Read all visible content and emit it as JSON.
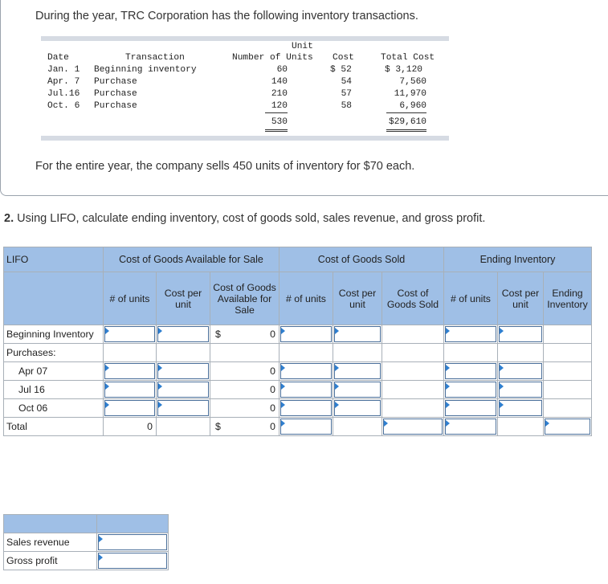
{
  "intro": {
    "sentence": "During  the year, TRC Corporation has the following inventory transactions.",
    "closing": "For the entire year, the company sells 450 units of inventory for $70 each."
  },
  "transactions": {
    "headers": {
      "date": "Date",
      "transaction": "Transaction",
      "units": "Number of Units",
      "unit_cost_top": "Unit",
      "unit_cost": "Cost",
      "total_cost": "Total Cost"
    },
    "rows": [
      {
        "date": "Jan. 1",
        "transaction": "Beginning inventory",
        "units": "60",
        "unit_cost": "$ 52",
        "total_cost": "$ 3,120"
      },
      {
        "date": "Apr. 7",
        "transaction": "Purchase",
        "units": "140",
        "unit_cost": "54",
        "total_cost": "7,560"
      },
      {
        "date": "Jul.16",
        "transaction": "Purchase",
        "units": "210",
        "unit_cost": "57",
        "total_cost": "11,970"
      },
      {
        "date": "Oct. 6",
        "transaction": "Purchase",
        "units": "120",
        "unit_cost": "58",
        "total_cost": "6,960"
      }
    ],
    "totals": {
      "units": "530",
      "total_cost": "$29,610"
    }
  },
  "question": {
    "number": "2.",
    "text": " Using LIFO, calculate ending inventory, cost of goods sold, sales revenue, and gross profit."
  },
  "lifo_table": {
    "method_label": "LIFO",
    "groups": {
      "available": "Cost of Goods Available for Sale",
      "sold": "Cost of Goods Sold",
      "ending": "Ending Inventory"
    },
    "subheaders": {
      "units": "# of units",
      "cost_per_unit": "Cost per unit",
      "cogas": "Cost of Goods Available for Sale",
      "units2": "# of units",
      "cost_per_unit2": "Cost per unit",
      "cogs": "Cost of Goods Sold",
      "units3": "# of units",
      "cost_per_unit3": "Cost per unit",
      "ending_inventory": "Ending Inventory"
    },
    "rows": {
      "beginning": {
        "label": "Beginning Inventory",
        "dollar": "$",
        "cogas": "0"
      },
      "purchases": {
        "label": "Purchases:"
      },
      "apr": {
        "label": "Apr 07",
        "cogas": "0"
      },
      "jul": {
        "label": "Jul 16",
        "cogas": "0"
      },
      "oct": {
        "label": "Oct 06",
        "cogas": "0"
      },
      "total": {
        "label": "Total",
        "units": "0",
        "dollar": "$",
        "cogas": "0"
      }
    }
  },
  "summary": {
    "sales_revenue": "Sales revenue",
    "gross_profit": "Gross profit"
  }
}
